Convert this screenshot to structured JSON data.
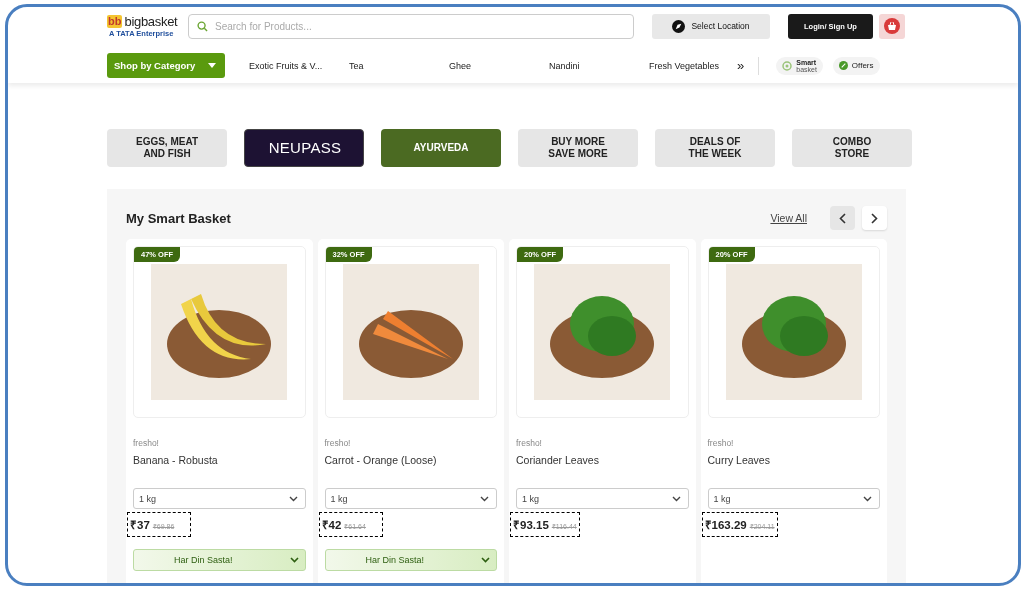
{
  "header": {
    "logo": {
      "mark": "bb",
      "name": "bigbasket",
      "tagline": "A TATA Enterprise"
    },
    "search": {
      "placeholder": "Search for Products..."
    },
    "location_button": "Select Location",
    "login_button": "Login/ Sign Up"
  },
  "nav": {
    "category_button": "Shop by Category",
    "links": [
      "Exotic Fruits & V...",
      "Tea",
      "Ghee",
      "Nandini",
      "Fresh Vegetables"
    ],
    "more": "»",
    "smart_basket": {
      "line1": "Smart",
      "line2": "basket"
    },
    "offers": "Offers"
  },
  "tiles": [
    {
      "label": "EGGS, MEAT AND FISH",
      "kind": "plain"
    },
    {
      "label": "NEUPASS",
      "kind": "neupass"
    },
    {
      "label": "AYURVEDA",
      "kind": "green"
    },
    {
      "label": "BUY MORE SAVE MORE",
      "kind": "plain"
    },
    {
      "label": "DEALS OF THE WEEK",
      "kind": "plain"
    },
    {
      "label": "COMBO STORE",
      "kind": "plain"
    }
  ],
  "section": {
    "title": "My Smart Basket",
    "view_all": "View All",
    "products": [
      {
        "discount": "47% OFF",
        "brand": "fresho!",
        "name": "Banana - Robusta",
        "pack": "1 kg",
        "price": "₹37",
        "mrp": "₹69.86",
        "offer": "Har Din Sasta!"
      },
      {
        "discount": "32% OFF",
        "brand": "fresho!",
        "name": "Carrot - Orange (Loose)",
        "pack": "1 kg",
        "price": "₹42",
        "mrp": "₹61.64",
        "offer": "Har Din Sasta!"
      },
      {
        "discount": "20% OFF",
        "brand": "fresho!",
        "name": "Coriander Leaves",
        "pack": "1 kg",
        "price": "₹93.15",
        "mrp": "₹116.44"
      },
      {
        "discount": "20% OFF",
        "brand": "fresho!",
        "name": "Curry Leaves",
        "pack": "1 kg",
        "price": "₹163.29",
        "mrp": "₹204.11"
      }
    ]
  }
}
